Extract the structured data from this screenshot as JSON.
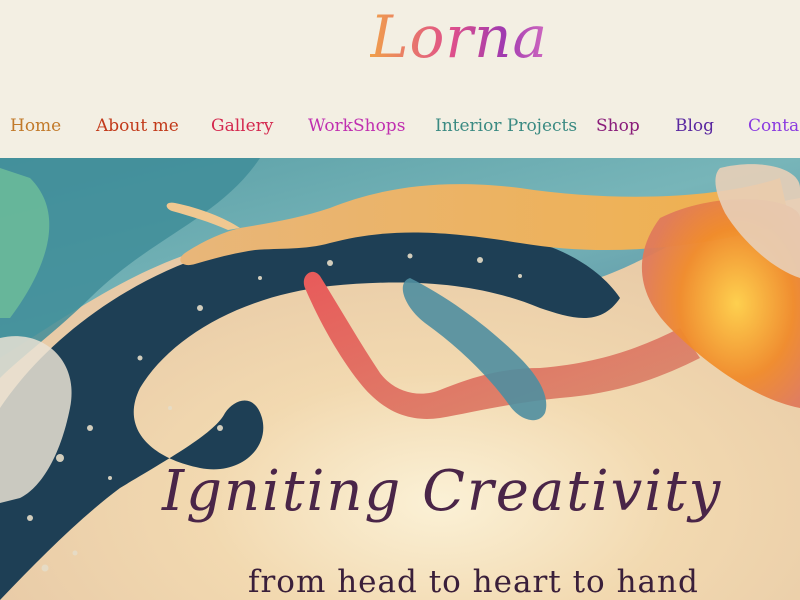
{
  "site": {
    "logo_text": "Lorna"
  },
  "nav": {
    "items": [
      {
        "label": "Home",
        "color": "#c27a2a"
      },
      {
        "label": "About me",
        "color": "#c23a1a"
      },
      {
        "label": "Gallery",
        "color": "#d4284e"
      },
      {
        "label": "WorkShops",
        "color": "#c030b0"
      },
      {
        "label": "Interior Projects",
        "color": "#3a8a82"
      },
      {
        "label": "Shop",
        "color": "#8a1c7a"
      },
      {
        "label": "Blog",
        "color": "#5a28a0"
      },
      {
        "label": "Contact",
        "color": "#8a3ae0"
      }
    ]
  },
  "hero": {
    "title": "Igniting Creativity",
    "subtitle": "from head to heart to hand",
    "colors": {
      "title": "#4a2548",
      "subtitle": "#3a1f3a"
    }
  }
}
